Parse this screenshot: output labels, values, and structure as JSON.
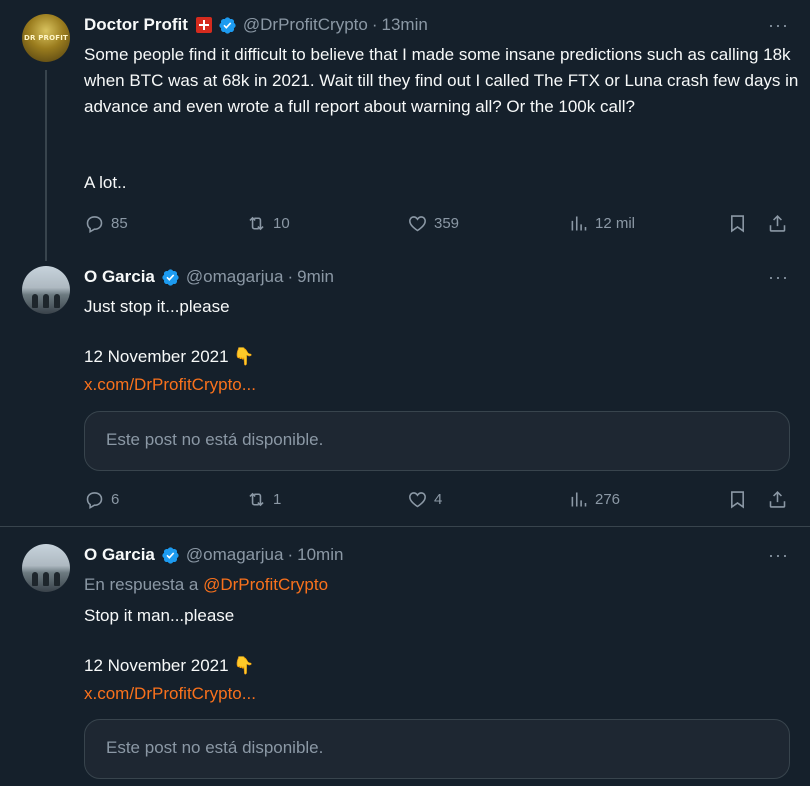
{
  "tweets": [
    {
      "name": "Doctor Profit",
      "avatar_text": "DR PROFIT",
      "handle": "@DrProfitCrypto",
      "time": "13min",
      "text": "Some people find it difficult to believe that I made some insane predictions such as calling 18k when BTC was at 68k in 2021. Wait till they find out I called The FTX or Luna crash few days in advance and even wrote a full report about warning all? Or the 100k call?",
      "text2": "A lot..",
      "replies": "85",
      "reposts": "10",
      "likes": "359",
      "views": "12 mil"
    },
    {
      "name": "O Garcia",
      "handle": "@omagarjua",
      "time": "9min",
      "text": "Just stop it...please",
      "date_line": "12 November 2021 👇",
      "link": "x.com/DrProfitCrypto...",
      "card": "Este post no está disponible.",
      "replies": "6",
      "reposts": "1",
      "likes": "4",
      "views": "276"
    },
    {
      "name": "O Garcia",
      "handle": "@omagarjua",
      "time": "10min",
      "reply_prefix": "En respuesta a",
      "reply_to": "@DrProfitCrypto",
      "text": "Stop it man...please",
      "date_line": "12 November 2021 👇",
      "link": "x.com/DrProfitCrypto...",
      "card": "Este post no está disponible."
    }
  ],
  "separator": "·",
  "icons": {
    "verified": "verified-badge-icon",
    "flag": "swiss-flag-icon",
    "more": "more-icon",
    "reply": "reply-icon",
    "repost": "repost-icon",
    "like": "like-icon",
    "views": "views-icon",
    "bookmark": "bookmark-icon",
    "share": "share-icon"
  },
  "colors": {
    "background": "#15202b",
    "accent": "#f9711c",
    "verified": "#1d9bf0",
    "muted": "#8b98a5",
    "divider": "#38444d"
  }
}
